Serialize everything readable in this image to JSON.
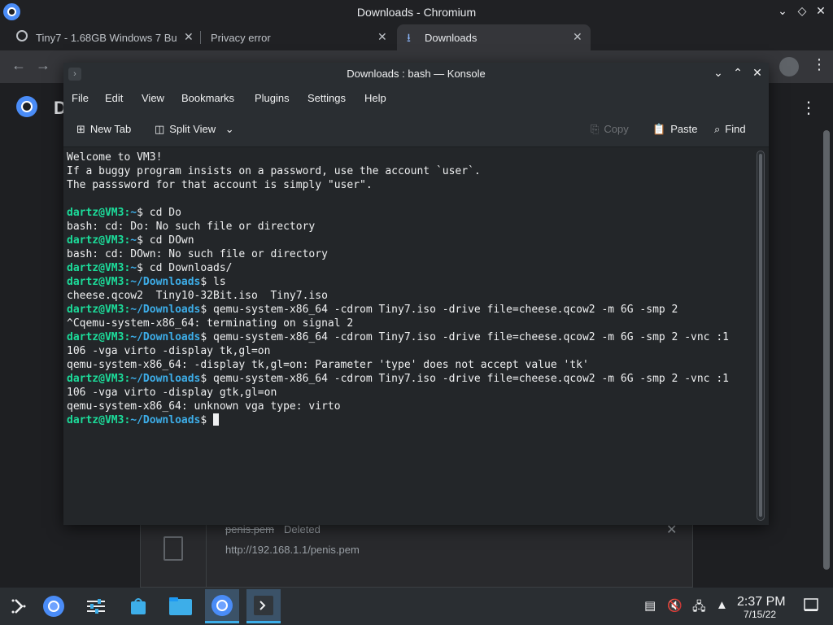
{
  "chrome": {
    "window_title": "Downloads - Chromium",
    "tabs": [
      {
        "label": "Tiny7 - 1.68GB Windows 7 Bu",
        "close": "✕"
      },
      {
        "label": "Privacy error",
        "close": "✕"
      },
      {
        "label": "Downloads",
        "close": "✕"
      }
    ],
    "new_tab": "+",
    "page_title_fragment": "D",
    "download": {
      "filename": "penis.pem",
      "status": "Deleted",
      "url": "http://192.168.1.1/penis.pem",
      "dismiss": "✕"
    }
  },
  "konsole": {
    "title": "Downloads : bash — Konsole",
    "menu": [
      "File",
      "Edit",
      "View",
      "Bookmarks",
      "Plugins",
      "Settings",
      "Help"
    ],
    "toolbar": {
      "new_tab": "New Tab",
      "split_view": "Split View",
      "copy": "Copy",
      "paste": "Paste",
      "find": "Find"
    },
    "prompt_user": "dartz@VM3",
    "lines": [
      {
        "text": "Welcome to VM3!"
      },
      {
        "text": "If a buggy program insists on a password, use the account `user`."
      },
      {
        "text": "The passsword for that account is simply \"user\"."
      },
      {
        "text": ""
      },
      {
        "prompt": true,
        "path": "~",
        "cmd": " cd Do"
      },
      {
        "text": "bash: cd: Do: No such file or directory"
      },
      {
        "prompt": true,
        "path": "~",
        "cmd": " cd DOwn"
      },
      {
        "text": "bash: cd: DOwn: No such file or directory"
      },
      {
        "prompt": true,
        "path": "~",
        "cmd": " cd Downloads/"
      },
      {
        "prompt": true,
        "path": "~/Downloads",
        "cmd": " ls"
      },
      {
        "text": "cheese.qcow2  Tiny10-32Bit.iso  Tiny7.iso"
      },
      {
        "prompt": true,
        "path": "~/Downloads",
        "cmd": " qemu-system-x86_64 -cdrom Tiny7.iso -drive file=cheese.qcow2 -m 6G -smp 2"
      },
      {
        "text": "^Cqemu-system-x86_64: terminating on signal 2"
      },
      {
        "prompt": true,
        "path": "~/Downloads",
        "cmd": " qemu-system-x86_64 -cdrom Tiny7.iso -drive file=cheese.qcow2 -m 6G -smp 2 -vnc :1"
      },
      {
        "text": "106 -vga virto -display tk,gl=on"
      },
      {
        "text": "qemu-system-x86_64: -display tk,gl=on: Parameter 'type' does not accept value 'tk'"
      },
      {
        "prompt": true,
        "path": "~/Downloads",
        "cmd": " qemu-system-x86_64 -cdrom Tiny7.iso -drive file=cheese.qcow2 -m 6G -smp 2 -vnc :1"
      },
      {
        "text": "106 -vga virto -display gtk,gl=on"
      },
      {
        "text": "qemu-system-x86_64: unknown vga type: virto"
      },
      {
        "prompt": true,
        "path": "~/Downloads",
        "cmd": " ",
        "cursor": true
      }
    ]
  },
  "taskbar": {
    "time": "2:37 PM",
    "date": "7/15/22"
  }
}
